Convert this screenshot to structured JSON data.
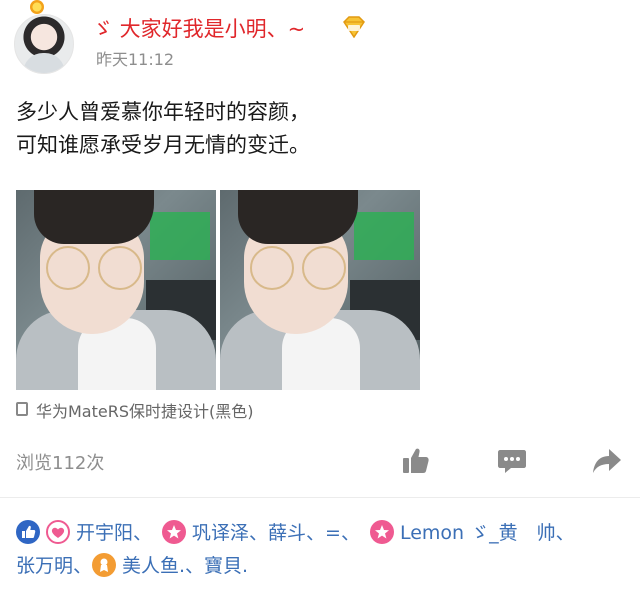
{
  "post": {
    "user_name": "ゞ 大家好我是小明、~",
    "time": "昨天11:12",
    "text_lines": [
      "多少人曾爱慕你年轻时的容颜，",
      "可知谁愿承受岁月无情的变迁。"
    ],
    "device": "华为MateRS保时捷设计(黑色)"
  },
  "stats": {
    "views": "浏览112次"
  },
  "likes": {
    "line1": [
      "开宇阳、",
      "巩译泽、",
      "薛斗、",
      "=、",
      "Lemon ゞ_黄　帅、"
    ],
    "line2": [
      "张万明、",
      "美人鱼.、寶貝."
    ]
  },
  "colors": {
    "name_red": "#e0272b",
    "link_blue": "#3b6fb6",
    "gray_text": "#8e8e8e"
  },
  "icons": [
    "avatar",
    "crown-icon",
    "vip-badge-icon",
    "phone-icon",
    "thumbs-up-icon",
    "comment-icon",
    "share-icon",
    "like-badge-icon",
    "heart-badge-icon",
    "star-badge-icon",
    "medal-badge-icon"
  ]
}
